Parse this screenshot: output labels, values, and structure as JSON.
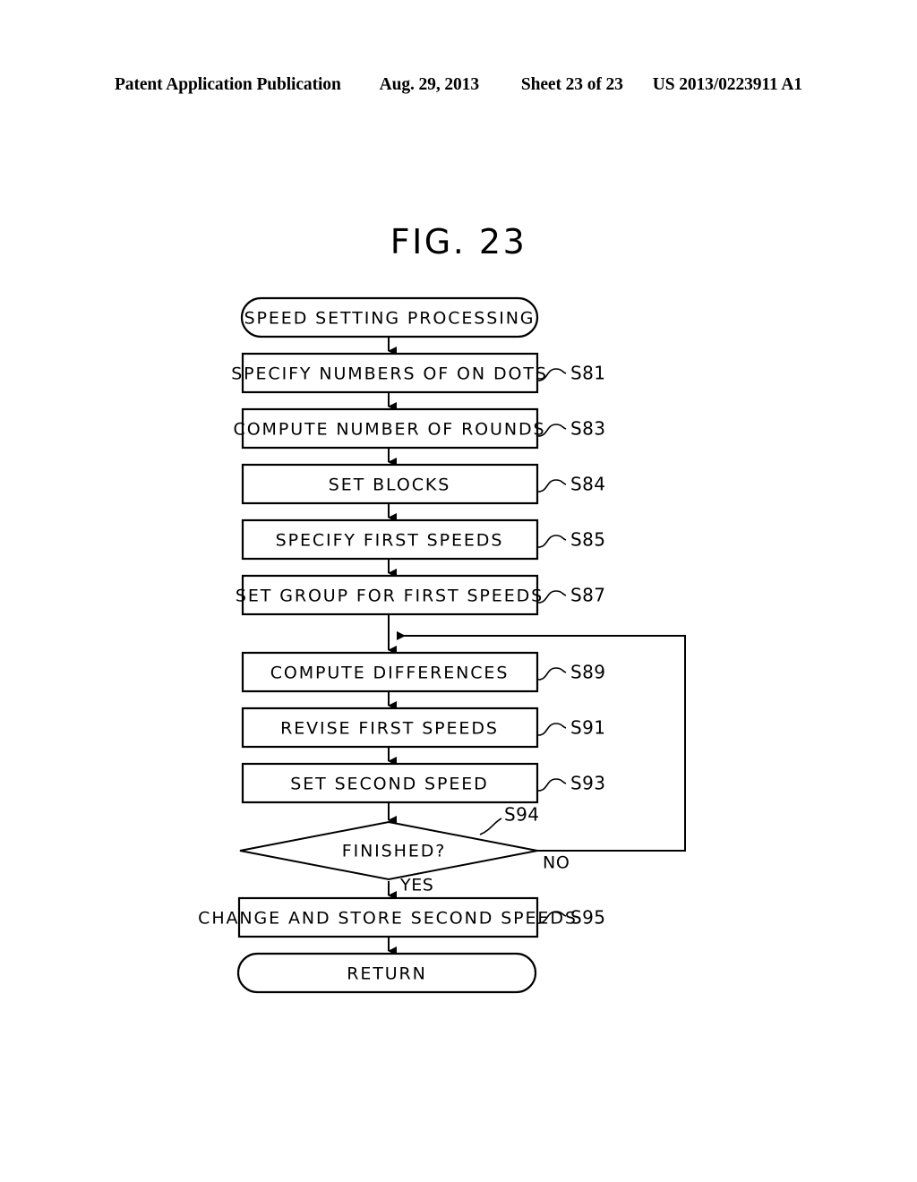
{
  "header": {
    "left": "Patent Application Publication",
    "date": "Aug. 29, 2013",
    "sheet": "Sheet 23 of 23",
    "publication_number": "US 2013/0223911 A1"
  },
  "figure": {
    "title": "FIG. 23"
  },
  "flowchart": {
    "start": {
      "text": "SPEED SETTING PROCESSING",
      "shape": "stadium"
    },
    "end": {
      "text": "RETURN",
      "shape": "stadium"
    },
    "steps": [
      {
        "text": "SPECIFY NUMBERS OF ON DOTS",
        "label": "S81"
      },
      {
        "text": "COMPUTE NUMBER OF ROUNDS",
        "label": "S83"
      },
      {
        "text": "SET BLOCKS",
        "label": "S84"
      },
      {
        "text": "SPECIFY FIRST SPEEDS",
        "label": "S85"
      },
      {
        "text": "SET GROUP FOR FIRST SPEEDS",
        "label": "S87"
      },
      {
        "text": "COMPUTE DIFFERENCES",
        "label": "S89"
      },
      {
        "text": "REVISE FIRST SPEEDS",
        "label": "S91"
      },
      {
        "text": "SET SECOND SPEED",
        "label": "S93"
      }
    ],
    "decision": {
      "text": "FINISHED?",
      "label": "S94",
      "yes_label": "YES",
      "no_label": "NO"
    },
    "final_step": {
      "text": "CHANGE AND STORE SECOND SPEEDS",
      "label": "S95"
    }
  }
}
